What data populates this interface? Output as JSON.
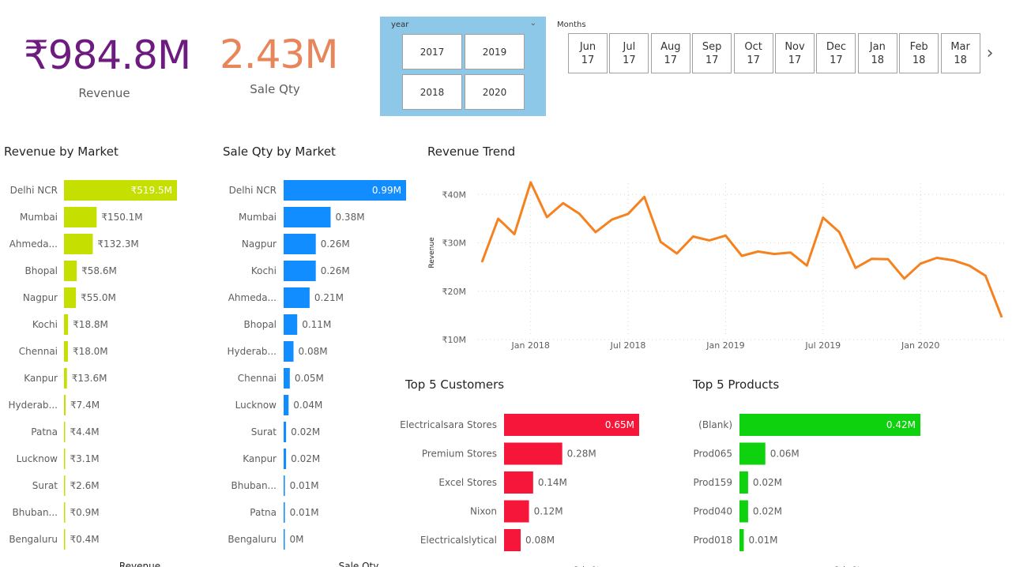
{
  "kpis": {
    "revenue": {
      "value": "₹984.8M",
      "label": "Revenue",
      "color": "#6e1b7f"
    },
    "sale_qty": {
      "value": "2.43M",
      "label": "Sale Qty",
      "color": "#e8865b"
    }
  },
  "year_slicer": {
    "title": "year",
    "chevron_icon": "chevron-down-icon",
    "options": [
      "2017",
      "2019",
      "2018",
      "2020"
    ],
    "background": "#8dc8e8"
  },
  "months_slicer": {
    "title": "Months",
    "items": [
      {
        "month": "Jun",
        "year": "17"
      },
      {
        "month": "Jul",
        "year": "17"
      },
      {
        "month": "Aug",
        "year": "17"
      },
      {
        "month": "Sep",
        "year": "17"
      },
      {
        "month": "Oct",
        "year": "17"
      },
      {
        "month": "Nov",
        "year": "17"
      },
      {
        "month": "Dec",
        "year": "17"
      },
      {
        "month": "Jan",
        "year": "18"
      },
      {
        "month": "Feb",
        "year": "18"
      },
      {
        "month": "Mar",
        "year": "18"
      }
    ],
    "next_icon": "chevron-right-icon"
  },
  "visual_titles": {
    "revenue_by_market": "Revenue by Market",
    "sale_qty_by_market": "Sale Qty by Market",
    "revenue_trend": "Revenue Trend",
    "top_customers": "Top 5 Customers",
    "top_products": "Top 5 Products"
  },
  "chart_data": [
    {
      "id": "revenue_by_market",
      "type": "bar",
      "orientation": "horizontal",
      "title": "Revenue by Market",
      "xlabel": "Revenue",
      "color": "#c5e000",
      "categories": [
        "Delhi NCR",
        "Mumbai",
        "Ahmeda...",
        "Bhopal",
        "Nagpur",
        "Kochi",
        "Chennai",
        "Kanpur",
        "Hyderab...",
        "Patna",
        "Lucknow",
        "Surat",
        "Bhuban...",
        "Bengaluru"
      ],
      "values": [
        519.5,
        150.1,
        132.3,
        58.6,
        55.0,
        18.8,
        18.0,
        13.6,
        7.4,
        4.4,
        3.1,
        2.6,
        0.9,
        0.4
      ],
      "labels": [
        "₹519.5M",
        "₹150.1M",
        "₹132.3M",
        "₹58.6M",
        "₹55.0M",
        "₹18.8M",
        "₹18.0M",
        "₹13.6M",
        "₹7.4M",
        "₹4.4M",
        "₹3.1M",
        "₹2.6M",
        "₹0.9M",
        "₹0.4M"
      ]
    },
    {
      "id": "sale_qty_by_market",
      "type": "bar",
      "orientation": "horizontal",
      "title": "Sale Qty by Market",
      "xlabel": "Sale Qty",
      "color": "#118dff",
      "categories": [
        "Delhi NCR",
        "Mumbai",
        "Nagpur",
        "Kochi",
        "Ahmeda...",
        "Bhopal",
        "Hyderab...",
        "Chennai",
        "Lucknow",
        "Surat",
        "Kanpur",
        "Bhuban...",
        "Patna",
        "Bengaluru"
      ],
      "values": [
        0.99,
        0.38,
        0.26,
        0.26,
        0.21,
        0.11,
        0.08,
        0.05,
        0.04,
        0.02,
        0.02,
        0.01,
        0.01,
        0.0
      ],
      "labels": [
        "0.99M",
        "0.38M",
        "0.26M",
        "0.26M",
        "0.21M",
        "0.11M",
        "0.08M",
        "0.05M",
        "0.04M",
        "0.02M",
        "0.02M",
        "0.01M",
        "0.01M",
        "0M"
      ]
    },
    {
      "id": "revenue_trend",
      "type": "line",
      "title": "Revenue Trend",
      "ylabel": "Revenue",
      "color": "#f5821f",
      "x_ticks": [
        "Jan 2018",
        "Jul 2018",
        "Jan 2019",
        "Jul 2019",
        "Jan 2020"
      ],
      "y_ticks": [
        "₹10M",
        "₹20M",
        "₹30M",
        "₹40M"
      ],
      "ylim": [
        10,
        42
      ],
      "x": [
        "2017-10",
        "2017-11",
        "2017-12",
        "2018-01",
        "2018-02",
        "2018-03",
        "2018-04",
        "2018-05",
        "2018-06",
        "2018-07",
        "2018-08",
        "2018-09",
        "2018-10",
        "2018-11",
        "2018-12",
        "2019-01",
        "2019-02",
        "2019-03",
        "2019-04",
        "2019-05",
        "2019-06",
        "2019-07",
        "2019-08",
        "2019-09",
        "2019-10",
        "2019-11",
        "2019-12",
        "2020-01",
        "2020-02",
        "2020-03",
        "2020-04",
        "2020-05",
        "2020-06"
      ],
      "values": [
        26.0,
        35.0,
        31.8,
        42.5,
        35.3,
        38.2,
        36.0,
        32.2,
        34.8,
        36.0,
        39.5,
        30.2,
        27.8,
        31.3,
        30.5,
        31.5,
        27.3,
        28.2,
        27.7,
        28.0,
        25.3,
        35.2,
        32.2,
        24.8,
        26.7,
        26.6,
        22.6,
        25.7,
        26.9,
        26.4,
        25.3,
        23.2,
        14.6
      ],
      "grid": true
    },
    {
      "id": "top_customers",
      "type": "bar",
      "orientation": "horizontal",
      "title": "Top 5 Customers",
      "xlabel": "Sale Qty",
      "color": "#f5163a",
      "categories": [
        "Electricalsara Stores",
        "Premium Stores",
        "Excel Stores",
        "Nixon",
        "Electricalslytical"
      ],
      "values": [
        0.65,
        0.28,
        0.14,
        0.12,
        0.08
      ],
      "labels": [
        "0.65M",
        "0.28M",
        "0.14M",
        "0.12M",
        "0.08M"
      ]
    },
    {
      "id": "top_products",
      "type": "bar",
      "orientation": "horizontal",
      "title": "Top 5 Products",
      "xlabel": "Sale Qty",
      "color": "#0dd20d",
      "categories": [
        "(Blank)",
        "Prod065",
        "Prod159",
        "Prod040",
        "Prod018"
      ],
      "values": [
        0.42,
        0.06,
        0.02,
        0.02,
        0.01
      ],
      "labels": [
        "0.42M",
        "0.06M",
        "0.02M",
        "0.02M",
        "0.01M"
      ]
    }
  ]
}
